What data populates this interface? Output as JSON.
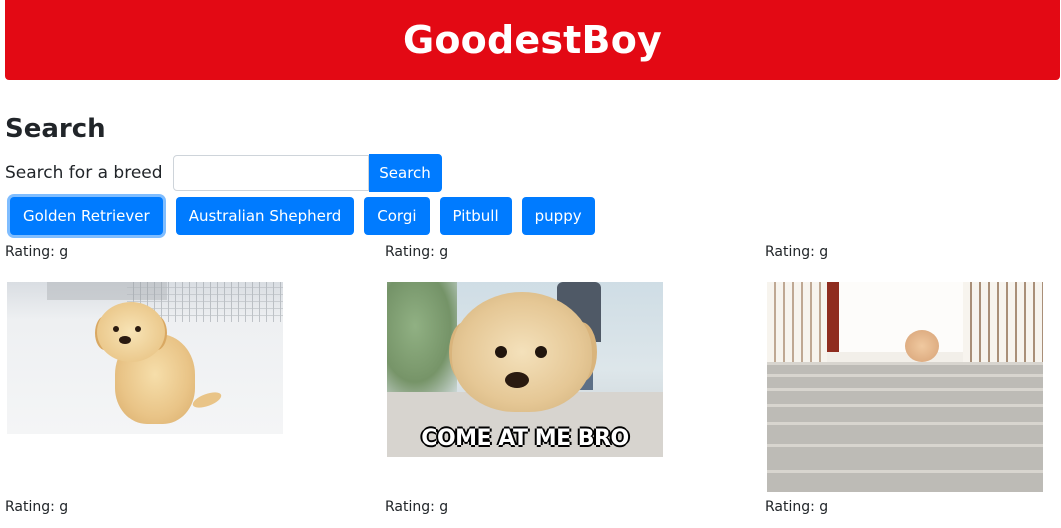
{
  "header": {
    "title": "GoodestBoy"
  },
  "search": {
    "heading": "Search",
    "label": "Search for a breed",
    "value": "",
    "placeholder": "",
    "button_label": "Search"
  },
  "breed_buttons": [
    {
      "label": "Golden Retriever",
      "active": true
    },
    {
      "label": "Australian Shepherd",
      "active": false
    },
    {
      "label": "Corgi",
      "active": false
    },
    {
      "label": "Pitbull",
      "active": false
    },
    {
      "label": "puppy",
      "active": false
    }
  ],
  "results": [
    {
      "rating_text": "Rating: g",
      "caption": ""
    },
    {
      "rating_text": "Rating: g",
      "caption": "COME AT ME BRO"
    },
    {
      "rating_text": "Rating: g",
      "caption": ""
    },
    {
      "rating_text": "Rating: g",
      "caption": ""
    },
    {
      "rating_text": "Rating: g",
      "caption": ""
    },
    {
      "rating_text": "Rating: g",
      "caption": ""
    }
  ],
  "colors": {
    "header_bg": "#e30914",
    "primary": "#007bff"
  }
}
